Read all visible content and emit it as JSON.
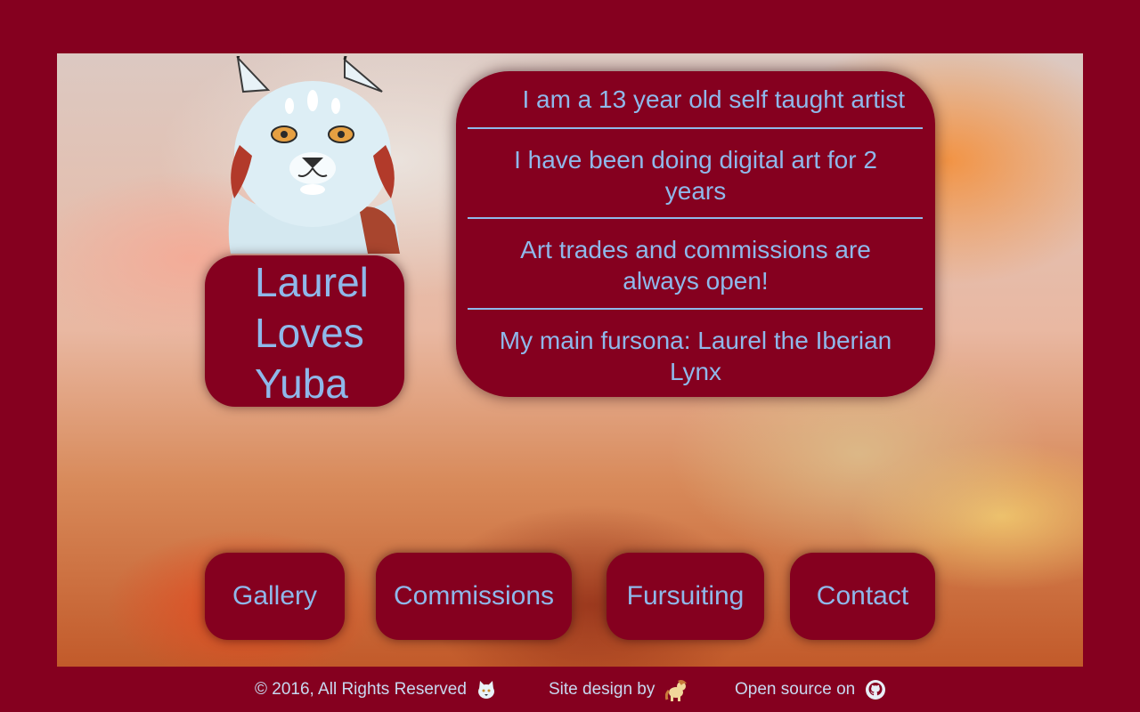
{
  "title_card": {
    "line1": "Laurel",
    "line2": "Loves",
    "line3": "Yuba"
  },
  "info": {
    "item1": "I am a 13 year old self taught artist",
    "item2": "I have been doing digital art for 2 years",
    "item3": "Art trades and commissions are always open!",
    "item4": "My main fursona: Laurel the Iberian Lynx"
  },
  "nav": {
    "gallery": "Gallery",
    "commissions": "Commissions",
    "fursuiting": "Fursuiting",
    "contact": "Contact"
  },
  "footer": {
    "copyright": "© 2016, All Rights Reserved",
    "design": "Site design by",
    "source": "Open source on"
  },
  "colors": {
    "frame": "#85001f",
    "text": "#8fb8ea"
  },
  "icons": {
    "avatar": "lynx-portrait",
    "copyright_icon": "cat-face-icon",
    "design_icon": "pony-icon",
    "source_icon": "github-icon"
  }
}
